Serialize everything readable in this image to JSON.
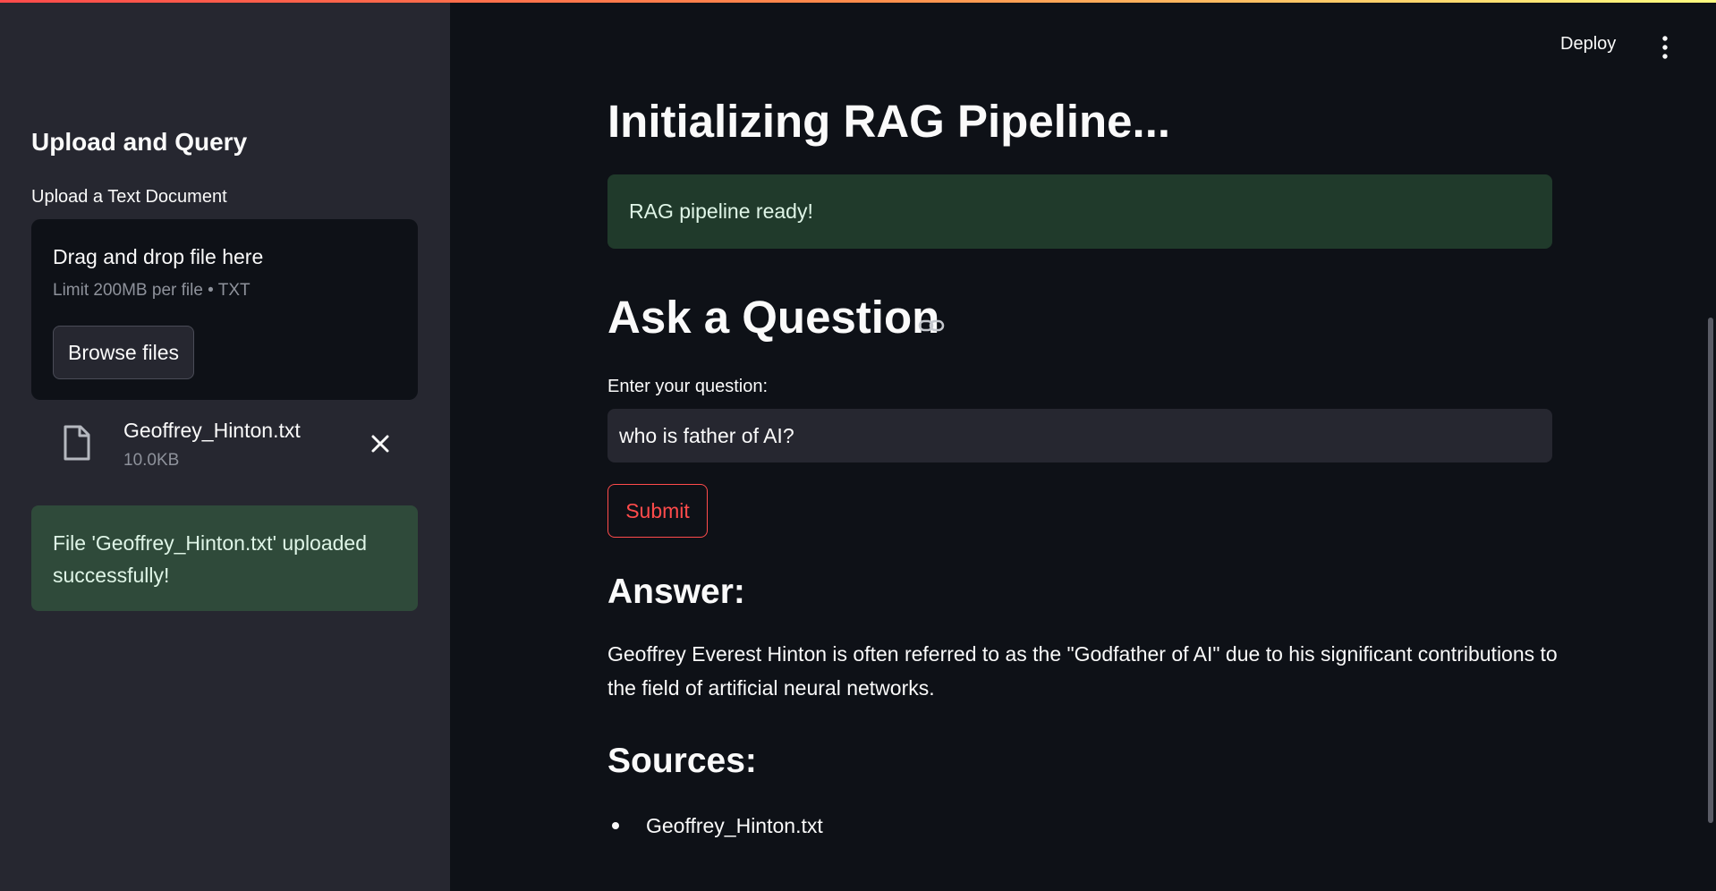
{
  "sidebar": {
    "title": "Upload and Query",
    "upload_label": "Upload a Text Document",
    "dropzone": {
      "title": "Drag and drop file here",
      "hint": "Limit 200MB per file • TXT",
      "browse_label": "Browse files"
    },
    "uploaded_file": {
      "name": "Geoffrey_Hinton.txt",
      "size": "10.0KB"
    },
    "success_message": "File 'Geoffrey_Hinton.txt' uploaded successfully!"
  },
  "header": {
    "deploy_label": "Deploy"
  },
  "main": {
    "title": "Initializing RAG Pipeline...",
    "ready_message": "RAG pipeline ready!",
    "ask_heading": "Ask a Question",
    "question_label": "Enter your question:",
    "question_value": "who is father of AI?",
    "submit_label": "Submit",
    "answer_heading": "Answer:",
    "answer_text": "Geoffrey Everest Hinton is often referred to as the \"Godfather of AI\" due to his significant contributions to the field of artificial neural networks.",
    "sources_heading": "Sources:",
    "sources": [
      "Geoffrey_Hinton.txt"
    ]
  },
  "colors": {
    "background": "#0e1117",
    "sidebar": "#262730",
    "primary": "#ff4b4b",
    "success_bg": "#203a2b",
    "text": "#fafafa"
  },
  "icons": {
    "file": "file-icon",
    "remove": "close-icon",
    "link": "link-icon",
    "menu": "kebab-menu-icon"
  }
}
